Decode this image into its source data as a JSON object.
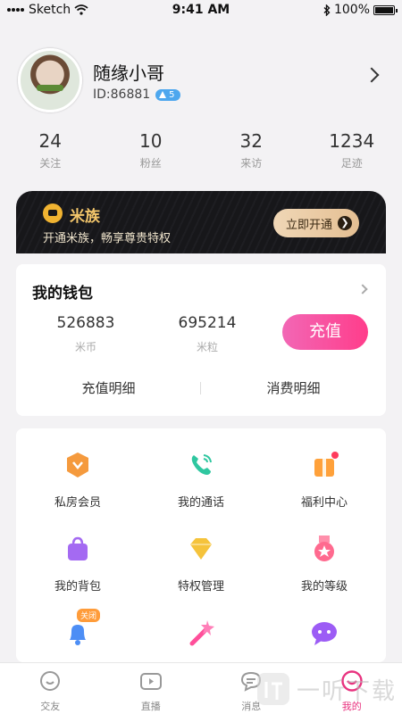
{
  "status_bar": {
    "carrier": "Sketch",
    "time": "9:41 AM",
    "battery": "100%"
  },
  "profile": {
    "name": "随缘小哥",
    "id": "ID:86881",
    "level": "5"
  },
  "stats": [
    {
      "value": "24",
      "label": "关注"
    },
    {
      "value": "10",
      "label": "粉丝"
    },
    {
      "value": "32",
      "label": "来访"
    },
    {
      "value": "1234",
      "label": "足迹"
    }
  ],
  "vip": {
    "title": "米族",
    "description": "开通米族，畅享尊贵特权",
    "button": "立即开通"
  },
  "wallet": {
    "title": "我的钱包",
    "coins": {
      "value": "526883",
      "label": "米币"
    },
    "grains": {
      "value": "695214",
      "label": "米粒"
    },
    "recharge_button": "充值",
    "links": [
      "充值明细",
      "消费明细"
    ]
  },
  "menu": {
    "items": [
      {
        "label": "私房会员",
        "icon": "vip-shield-icon",
        "color": "#f59a3d"
      },
      {
        "label": "我的通话",
        "icon": "phone-icon",
        "color": "#2fc7a0"
      },
      {
        "label": "福利中心",
        "icon": "gift-icon",
        "color": "#ffa13a"
      },
      {
        "label": "我的背包",
        "icon": "bag-icon",
        "color": "#a46af2"
      },
      {
        "label": "特权管理",
        "icon": "diamond-icon",
        "color": "#f5c33b"
      },
      {
        "label": "我的等级",
        "icon": "medal-icon",
        "color": "#ff6a8f"
      },
      {
        "label": "",
        "icon": "bell-icon",
        "color": "#4d8ef5",
        "tag": "关闭"
      },
      {
        "label": "",
        "icon": "magic-wand-icon",
        "color": "#ff4f9a"
      },
      {
        "label": "",
        "icon": "chat-bubble-icon",
        "color": "#9c5cf5"
      }
    ]
  },
  "tabs": [
    {
      "label": "交友",
      "active": false
    },
    {
      "label": "直播",
      "active": false
    },
    {
      "label": "消息",
      "active": false
    },
    {
      "label": "我的",
      "active": true
    }
  ],
  "watermark": {
    "text": "一听下载"
  },
  "colors": {
    "accent": "#e8337f",
    "vip_gold": "#f3c66b",
    "background": "#f3f2f4"
  }
}
